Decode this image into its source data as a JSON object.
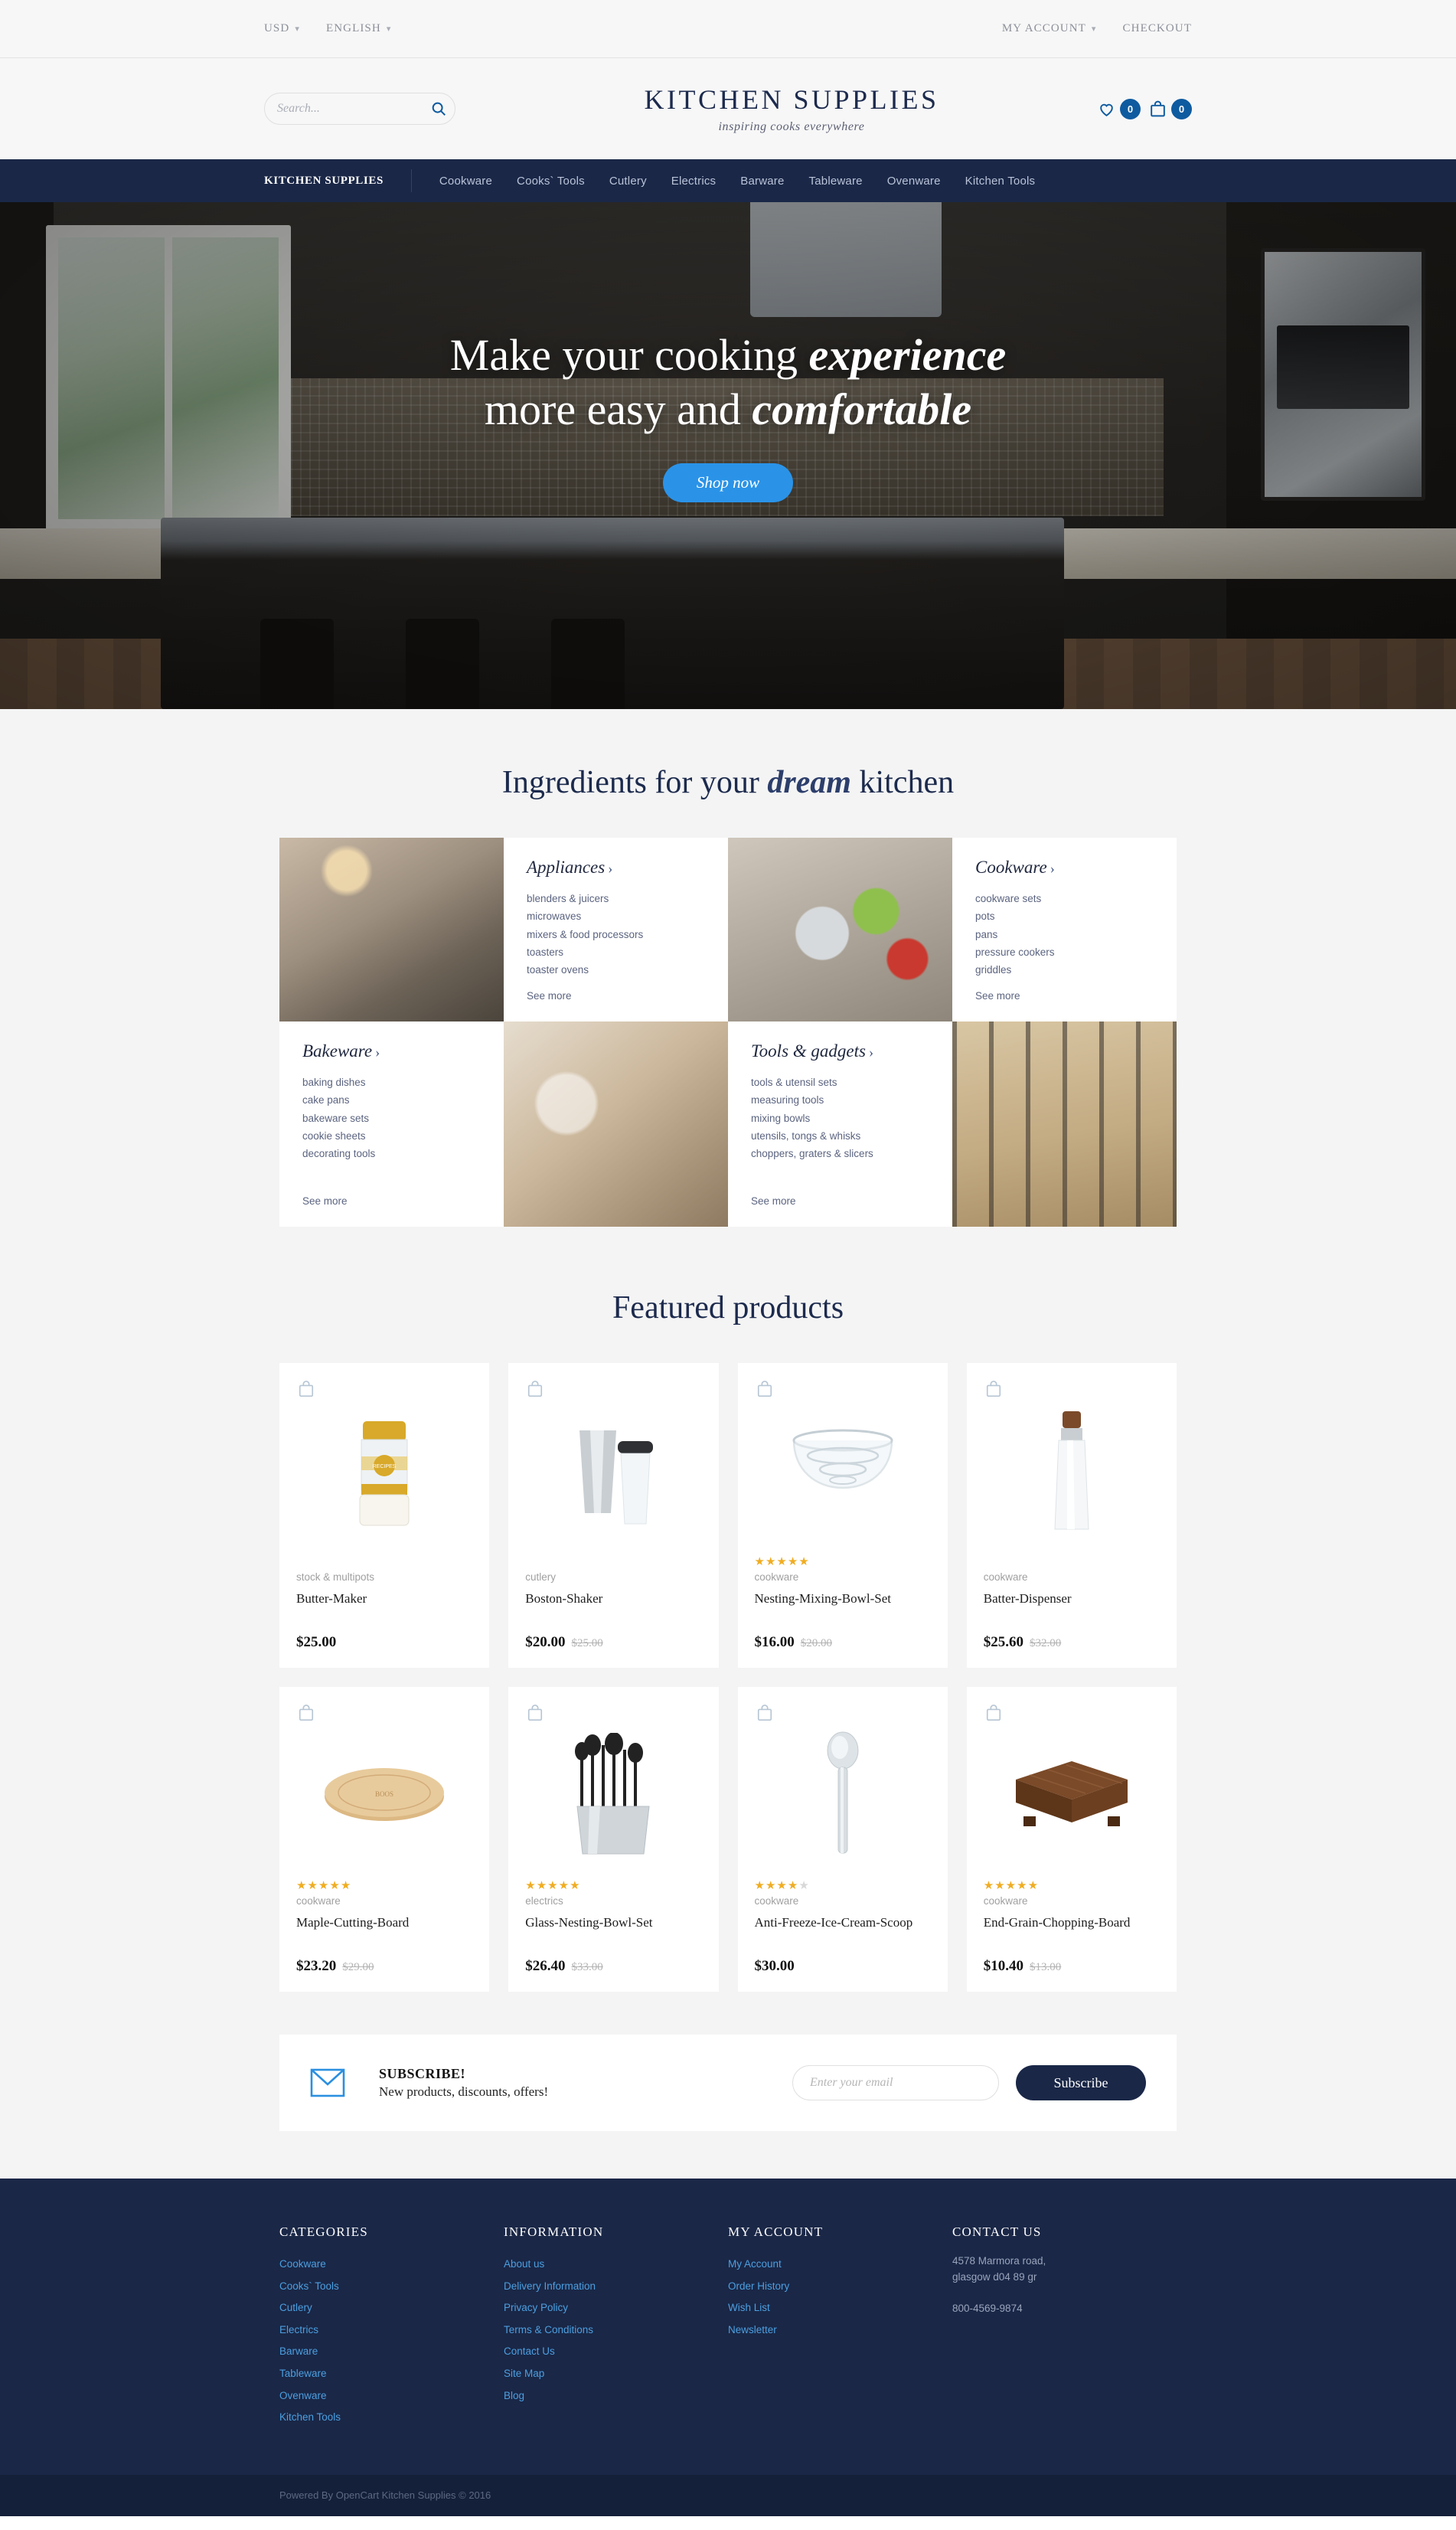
{
  "topbar": {
    "currency": "USD",
    "language": "ENGLISH",
    "my_account": "MY ACCOUNT",
    "checkout": "CHECKOUT"
  },
  "header": {
    "search_placeholder": "Search...",
    "brand_title": "KITCHEN SUPPLIES",
    "brand_tagline": "inspiring cooks everywhere",
    "wishlist_count": "0",
    "cart_count": "0"
  },
  "nav": {
    "brand": "KITCHEN SUPPLIES",
    "links": [
      "Cookware",
      "Cooks` Tools",
      "Cutlery",
      "Electrics",
      "Barware",
      "Tableware",
      "Ovenware",
      "Kitchen Tools"
    ]
  },
  "hero": {
    "line1_a": "Make your cooking ",
    "line1_b": "experience",
    "line2_a": "more easy and ",
    "line2_b": "comfortable",
    "button": "Shop now"
  },
  "categories_section": {
    "title_a": "Ingredients for your ",
    "title_b": "dream",
    "title_c": " kitchen",
    "see_more": "See more",
    "cards": [
      {
        "name": "Appliances",
        "items": [
          "blenders & juicers",
          "microwaves",
          "mixers & food processors",
          "toasters",
          "toaster ovens"
        ]
      },
      {
        "name": "Cookware",
        "items": [
          "cookware sets",
          "pots",
          "pans",
          "pressure cookers",
          "griddles"
        ]
      },
      {
        "name": "Bakeware",
        "items": [
          "baking dishes",
          "cake pans",
          "bakeware sets",
          "cookie sheets",
          "decorating tools"
        ]
      },
      {
        "name": "Tools & gadgets",
        "items": [
          "tools & utensil sets",
          "measuring tools",
          "mixing bowls",
          "utensils, tongs & whisks",
          "choppers, graters & slicers"
        ]
      }
    ]
  },
  "featured": {
    "title": "Featured products",
    "products": [
      {
        "category": "stock & multipots",
        "name": "Butter-Maker",
        "price": "$25.00",
        "old_price": "",
        "rating": 0,
        "art": "butter-maker"
      },
      {
        "category": "cutlery",
        "name": "Boston-Shaker",
        "price": "$20.00",
        "old_price": "$25.00",
        "rating": 0,
        "art": "boston-shaker"
      },
      {
        "category": "cookware",
        "name": "Nesting-Mixing-Bowl-Set",
        "price": "$16.00",
        "old_price": "$20.00",
        "rating": 5,
        "art": "nesting-bowls"
      },
      {
        "category": "cookware",
        "name": "Batter-Dispenser",
        "price": "$25.60",
        "old_price": "$32.00",
        "rating": 0,
        "art": "batter-dispenser"
      },
      {
        "category": "cookware",
        "name": "Maple-Cutting-Board",
        "price": "$23.20",
        "old_price": "$29.00",
        "rating": 5,
        "art": "maple-board"
      },
      {
        "category": "electrics",
        "name": "Glass-Nesting-Bowl-Set",
        "price": "$26.40",
        "old_price": "$33.00",
        "rating": 5,
        "art": "utensil-crock"
      },
      {
        "category": "cookware",
        "name": "Anti-Freeze-Ice-Cream-Scoop",
        "price": "$30.00",
        "old_price": "",
        "rating": 4,
        "art": "ice-scoop"
      },
      {
        "category": "cookware",
        "name": "End-Grain-Chopping-Board",
        "price": "$10.40",
        "old_price": "$13.00",
        "rating": 5,
        "art": "end-grain-board"
      }
    ]
  },
  "subscribe": {
    "title": "SUBSCRIBE!",
    "subtitle": "New products, discounts, offers!",
    "email_placeholder": "Enter your email",
    "button": "Subscribe"
  },
  "footer": {
    "columns": [
      {
        "heading": "CATEGORIES",
        "items": [
          "Cookware",
          "Cooks` Tools",
          "Cutlery",
          "Electrics",
          "Barware",
          "Tableware",
          "Ovenware",
          "Kitchen Tools"
        ]
      },
      {
        "heading": "INFORMATION",
        "items": [
          "About us",
          "Delivery Information",
          "Privacy Policy",
          "Terms & Conditions",
          "Contact Us",
          "Site Map",
          "Blog"
        ]
      },
      {
        "heading": "MY ACCOUNT",
        "items": [
          "My Account",
          "Order History",
          "Wish List",
          "Newsletter"
        ]
      }
    ],
    "contact": {
      "heading": "CONTACT US",
      "address_line1": "4578 Marmora road,",
      "address_line2": "glasgow d04 89 gr",
      "phone": "800-4569-9874"
    },
    "copyright": "Powered By OpenCart Kitchen Supplies © 2016"
  },
  "colors": {
    "navy": "#1a2747",
    "accent_blue": "#2a93e8",
    "badge_blue": "#0f5ba0",
    "link_blue": "#4c9fe0",
    "star_gold": "#f0ad22"
  }
}
